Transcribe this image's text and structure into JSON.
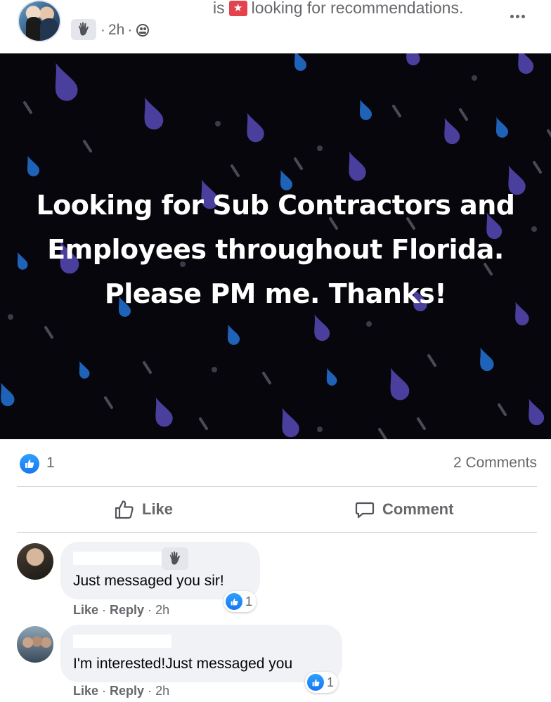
{
  "header": {
    "status_prefix": "is",
    "status_text": "looking for recommendations.",
    "timestamp": "2h",
    "separator": "·",
    "audience_icon": "group-icon",
    "badge_icon": "wave-hand-icon",
    "more_icon": "more-dots-icon"
  },
  "post": {
    "image_text": "Looking for Sub Contractors and Employees throughout Florida. Please PM me. Thanks!",
    "background_color": "#06060c"
  },
  "reactions": {
    "like_count": "1",
    "comments_label": "2 Comments"
  },
  "actions": {
    "like_label": "Like",
    "comment_label": "Comment"
  },
  "comments": [
    {
      "text": "Just messaged you sir!",
      "reaction_count": "1",
      "like_label": "Like",
      "reply_label": "Reply",
      "time": "2h",
      "separator": "·"
    },
    {
      "text": "I'm interested!Just messaged you",
      "reaction_count": "1",
      "like_label": "Like",
      "reply_label": "Reply",
      "time": "2h",
      "separator": "·"
    }
  ],
  "colors": {
    "brand_blue": "#1877f2",
    "secondary_text": "#65676b",
    "bubble_bg": "#f0f2f5",
    "drop_purple": "#4b3f9e",
    "drop_blue": "#1f63b8"
  }
}
